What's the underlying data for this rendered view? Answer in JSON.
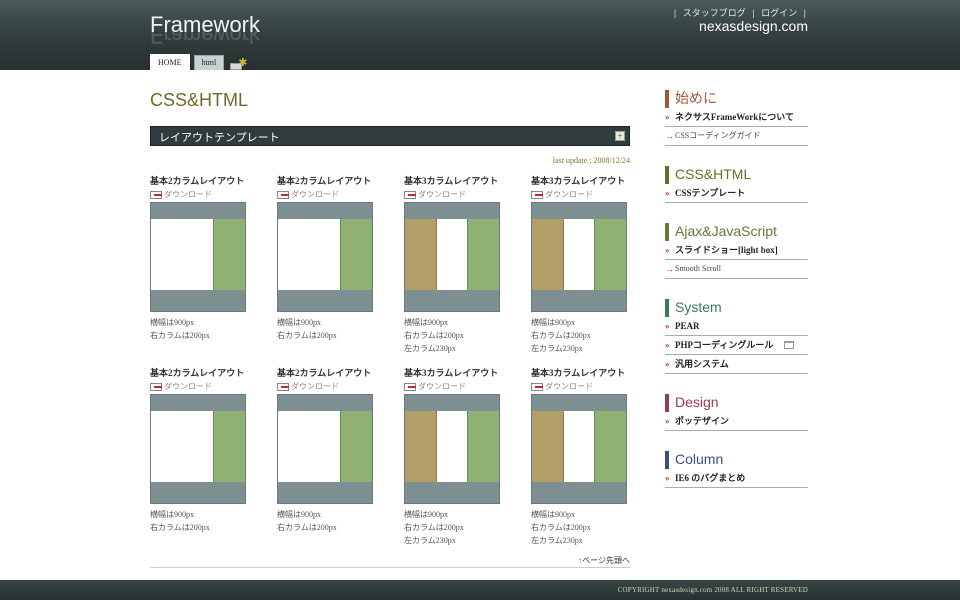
{
  "header": {
    "logo": "Framework",
    "top_links": [
      "スタッフブログ",
      "ログイン"
    ],
    "site_url": "nexasdesign.com",
    "tabs": [
      {
        "label": "HOME",
        "active": true
      },
      {
        "label": "html",
        "active": false
      }
    ]
  },
  "main": {
    "title": "CSS&HTML",
    "section_title": "レイアウトテンプレート",
    "last_update": "last update : 2008/12/24",
    "download_label": "ダウンロード",
    "cards": [
      {
        "title": "基本2カラムレイアウト",
        "cols": 2,
        "lines": [
          "横幅は900px",
          "右カラムは200px"
        ]
      },
      {
        "title": "基本2カラムレイアウト",
        "cols": 2,
        "lines": [
          "横幅は900px",
          "右カラムは200px"
        ]
      },
      {
        "title": "基本3カラムレイアウト",
        "cols": 3,
        "lines": [
          "横幅は900px",
          "右カラムは200px",
          "左カラム230px"
        ]
      },
      {
        "title": "基本3カラムレイアウト",
        "cols": 3,
        "lines": [
          "横幅は900px",
          "右カラムは200px",
          "左カラム230px"
        ]
      },
      {
        "title": "基本2カラムレイアウト",
        "cols": 2,
        "lines": [
          "横幅は900px",
          "右カラムは200px"
        ]
      },
      {
        "title": "基本2カラムレイアウト",
        "cols": 2,
        "lines": [
          "横幅は900px",
          "右カラムは200px"
        ]
      },
      {
        "title": "基本3カラムレイアウト",
        "cols": 3,
        "lines": [
          "横幅は900px",
          "右カラムは200px",
          "左カラム230px"
        ]
      },
      {
        "title": "基本3カラムレイアウト",
        "cols": 3,
        "lines": [
          "横幅は900px",
          "右カラムは200px",
          "左カラム230px"
        ]
      }
    ],
    "back_to_top": "ページ先頭へ"
  },
  "sidebar": [
    {
      "heading": "始めに",
      "color": "#9a5a3a",
      "items": [
        {
          "label": "ネクサスFrameWorkについて",
          "small": false
        },
        {
          "label": "CSSコーディングガイド",
          "small": true
        }
      ]
    },
    {
      "heading": "CSS&HTML",
      "color": "#6f6a25",
      "items": [
        {
          "label": "CSSテンプレート",
          "small": false
        }
      ]
    },
    {
      "heading": "Ajax&JavaScript",
      "color": "#5f7a35",
      "items": [
        {
          "label": "スライドショー[light box]",
          "small": false
        },
        {
          "label": "Smooth Scroll",
          "small": true
        }
      ]
    },
    {
      "heading": "System",
      "color": "#3a7a55",
      "items": [
        {
          "label": "PEAR",
          "small": false
        },
        {
          "label": "PHPコーディングルール",
          "small": false,
          "icon": true
        },
        {
          "label": "汎用システム",
          "small": false
        }
      ]
    },
    {
      "heading": "Design",
      "color": "#9a3a4a",
      "items": [
        {
          "label": "ポッテザイン",
          "small": false
        }
      ]
    },
    {
      "heading": "Column",
      "color": "#3a4f8a",
      "items": [
        {
          "label": "IE6 のバグまとめ",
          "small": false
        }
      ]
    }
  ],
  "footer": {
    "copyright": "COPYRIGHT nexasdesign.com 2008 ALL RIGHT RESERVED"
  }
}
